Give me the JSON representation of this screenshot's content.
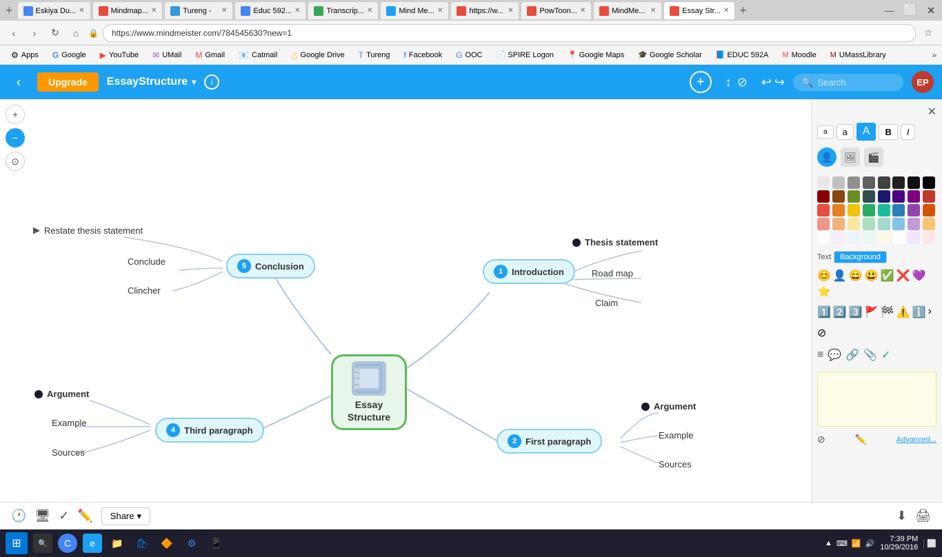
{
  "browser": {
    "tabs": [
      {
        "label": "Eskiya Du...",
        "favicon_color": "#4285f4",
        "active": false
      },
      {
        "label": "Mindmap...",
        "favicon_color": "#e74c3c",
        "active": false
      },
      {
        "label": "Tureng -",
        "favicon_color": "#3498db",
        "active": false
      },
      {
        "label": "Educ 592...",
        "favicon_color": "#4285f4",
        "active": false
      },
      {
        "label": "Transcrip...",
        "favicon_color": "#34a853",
        "active": false
      },
      {
        "label": "Mind Me...",
        "favicon_color": "#1da1f2",
        "active": false
      },
      {
        "label": "https://w...",
        "favicon_color": "#e74c3c",
        "active": false
      },
      {
        "label": "PowToon...",
        "favicon_color": "#e74c3c",
        "active": false
      },
      {
        "label": "MindMe...",
        "favicon_color": "#e74c3c",
        "active": false
      },
      {
        "label": "Essay Str...",
        "favicon_color": "#e74c3c",
        "active": true
      }
    ],
    "address": "https://www.mindmeister.com/784545630?new=1",
    "bookmarks": [
      {
        "label": "Apps",
        "color": "#4285f4"
      },
      {
        "label": "Google",
        "color": "#4285f4"
      },
      {
        "label": "YouTube",
        "color": "#e74c3c"
      },
      {
        "label": "UMail",
        "color": "#9b59b6"
      },
      {
        "label": "Gmail",
        "color": "#e74c3c"
      },
      {
        "label": "Catmail",
        "color": "#4285f4"
      },
      {
        "label": "Google Drive",
        "color": "#fbbc04"
      },
      {
        "label": "Tureng",
        "color": "#3498db"
      },
      {
        "label": "Facebook",
        "color": "#1877f2"
      },
      {
        "label": "OOC",
        "color": "#4285f4"
      },
      {
        "label": "SPIRE Logon",
        "color": "#555"
      },
      {
        "label": "Google Maps",
        "color": "#4285f4"
      },
      {
        "label": "Google Scholar",
        "color": "#4285f4"
      },
      {
        "label": "EDUC 592A",
        "color": "#1da1f2"
      },
      {
        "label": "Moodle",
        "color": "#e74c3c"
      },
      {
        "label": "UMassLibrary",
        "color": "#8B0000"
      }
    ]
  },
  "app_header": {
    "back_label": "‹",
    "upgrade_label": "Upgrade",
    "title": "EssayStructure",
    "add_label": "+",
    "search_placeholder": "Search",
    "avatar_label": "EP"
  },
  "mindmap": {
    "center_label": "Essay\nStructure",
    "nodes": {
      "introduction": {
        "label": "Introduction",
        "num": "1"
      },
      "first_paragraph": {
        "label": "First paragraph",
        "num": "2"
      },
      "third_paragraph": {
        "label": "Third paragraph",
        "num": "4"
      },
      "conclusion": {
        "label": "Conclusion",
        "num": "5"
      },
      "thesis": {
        "label": "Thesis statement"
      },
      "roadmap": {
        "label": "Road map"
      },
      "claim": {
        "label": "Claim"
      },
      "conclude": {
        "label": "Conclude"
      },
      "clincher": {
        "label": "Clincher"
      },
      "restate": {
        "label": "Restate thesis statement"
      },
      "argument_right": {
        "label": "Argument"
      },
      "example_right": {
        "label": "Example"
      },
      "sources_right": {
        "label": "Sources"
      },
      "argument_left": {
        "label": "Argument"
      },
      "example_left": {
        "label": "Example"
      },
      "sources_left": {
        "label": "Sources"
      }
    }
  },
  "right_panel": {
    "font_buttons": [
      "a",
      "a",
      "A",
      "B",
      "I"
    ],
    "text_label": "Text",
    "background_label": "Background",
    "advanced_label": "Advanced...",
    "note_placeholder": "",
    "colors": [
      "#e8e8e8",
      "#c0c0c0",
      "#909090",
      "#606060",
      "#404040",
      "#202020",
      "#101010",
      "#000000",
      "#8B0000",
      "#8B4513",
      "#6B8E23",
      "#2F4F4F",
      "#191970",
      "#4B0082",
      "#800080",
      "#c0392b",
      "#e74c3c",
      "#e67e22",
      "#f1c40f",
      "#27ae60",
      "#1abc9c",
      "#2980b9",
      "#8e44ad",
      "#d35400",
      "#f1948a",
      "#f0b27a",
      "#f9e79f",
      "#a9dfbf",
      "#a2d9ce",
      "#85c1e9",
      "#c39bd3",
      "#f8c471",
      "#fdfefe",
      "#f5eef8",
      "#eaf4fb",
      "#e9f7ef",
      "#fef9e7",
      "#fdfefe",
      "#f0e6ff",
      "#ffe6e6"
    ]
  },
  "bottom_bar": {
    "share_label": "Share",
    "share_arrow": "▾"
  },
  "taskbar": {
    "time": "7:39 PM",
    "date": "10/29/2016"
  }
}
